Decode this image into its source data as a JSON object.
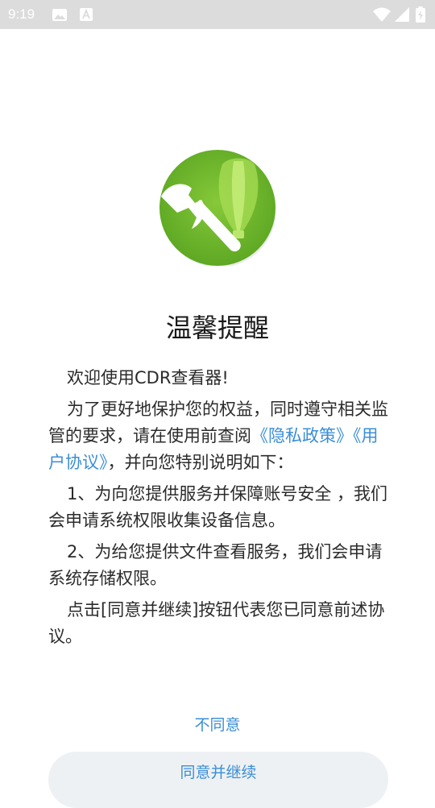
{
  "status_bar": {
    "time": "9:19",
    "icons": [
      "image-icon",
      "a-icon",
      "wifi-icon",
      "signal-icon",
      "battery-icon"
    ]
  },
  "dialog": {
    "title": "温馨提醒",
    "welcome": "欢迎使用CDR查看器!",
    "para2_prefix": "为了更好地保护您的权益，同时遵守相关监管的要求，请在使用前查阅",
    "privacy_link": "《隐私政策》",
    "user_agreement_link": "《用户协议》",
    "para2_suffix": "，并向您特别说明如下：",
    "item1": "1、为向您提供服务并保障账号安全 ，我们会申请系统权限收集设备信息。",
    "item2": "2、为给您提供文件查看服务，我们会申请系统存储权限。",
    "closing": "点击[同意并继续]按钮代表您已同意前述协议。",
    "disagree_label": "不同意",
    "agree_label": "同意并继续"
  },
  "colors": {
    "status_bar_bg": "#dcdcdc",
    "link": "#3b8ed6",
    "logo_green": "#6ab42a",
    "button_bg": "#eef1f4"
  }
}
